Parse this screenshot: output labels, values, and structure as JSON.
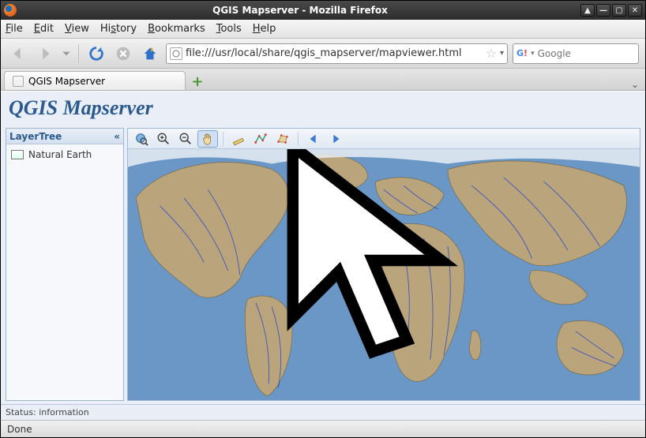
{
  "window": {
    "title": "QGIS Mapserver - Mozilla Firefox"
  },
  "menubar": {
    "items": [
      "File",
      "Edit",
      "View",
      "History",
      "Bookmarks",
      "Tools",
      "Help"
    ]
  },
  "nav": {
    "url": "file:///usr/local/share/qgis_mapserver/mapviewer.html",
    "search_placeholder": "Google"
  },
  "tabs": {
    "active_label": "QGIS Mapserver"
  },
  "page": {
    "heading": "QGIS Mapserver"
  },
  "layertree": {
    "title": "LayerTree",
    "items": [
      "Natural Earth"
    ]
  },
  "map_toolbar": {
    "tools": [
      "zoom-extent",
      "zoom-in",
      "zoom-out",
      "pan",
      "measure-line",
      "measure-path",
      "measure-area",
      "prev-view",
      "next-view"
    ]
  },
  "status": {
    "app": "Status: information",
    "browser": "Done"
  },
  "colors": {
    "heading": "#2b5a8e",
    "ocean": "#6a97c5",
    "land": "#b9a47c",
    "rivers": "#1a3fd1"
  }
}
